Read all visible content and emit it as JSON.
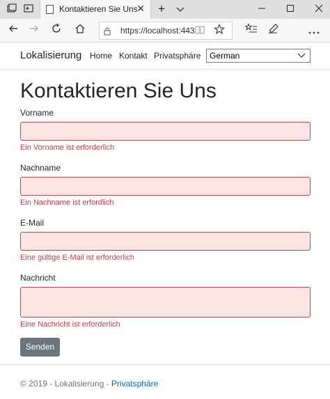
{
  "browser": {
    "tab_title": "Kontaktieren Sie Uns - L",
    "url": "https://localhost:443",
    "new_tab_symbol": "+",
    "tab_close_symbol": "✕"
  },
  "navbar": {
    "brand": "Lokalisierung",
    "links": [
      "Home",
      "Kontakt",
      "Privatsphäre"
    ],
    "language": {
      "selected": "German"
    }
  },
  "form": {
    "title": "Kontaktieren Sie Uns",
    "fields": [
      {
        "label": "Vorname",
        "value": "",
        "error": "Ein Vorname ist erforderlich"
      },
      {
        "label": "Nachname",
        "value": "",
        "error": "Ein Nachname ist erfordlich"
      },
      {
        "label": "E-Mail",
        "value": "",
        "error": "Eine gültige E-Mail ist erforderlich"
      },
      {
        "label": "Nachricht",
        "value": "",
        "error": "Eine Nachricht ist erforderlich"
      }
    ],
    "submit_label": "Senden"
  },
  "footer": {
    "copyright": "© 2019 - Lokalisierung - ",
    "link": "Privatsphäre"
  },
  "colors": {
    "error": "#dc3545",
    "error_bg": "#ffe4e4",
    "button": "#6c757d",
    "link": "#0366d6"
  }
}
